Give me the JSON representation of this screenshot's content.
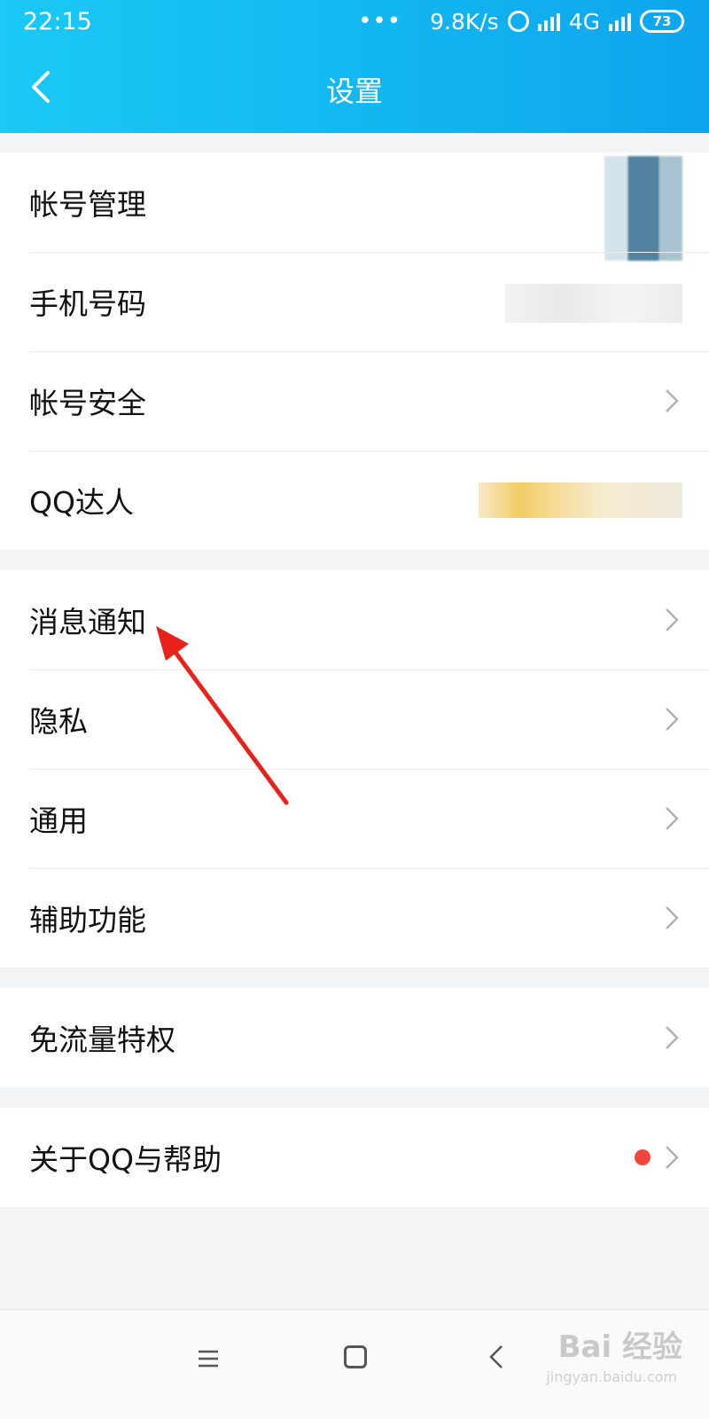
{
  "status_bar": {
    "time": "22:15",
    "dots": "•••",
    "speed": "9.8K/s",
    "network": "4G",
    "battery": "73"
  },
  "header": {
    "title": "设置"
  },
  "groups": [
    {
      "items": [
        {
          "label": "帐号管理",
          "icon": "blurred-avatar"
        },
        {
          "label": "手机号码",
          "icon": "blurred-phone"
        },
        {
          "label": "帐号安全",
          "icon": "chevron-right-icon"
        },
        {
          "label": "QQ达人",
          "icon": "blurred-badge"
        }
      ]
    },
    {
      "items": [
        {
          "label": "消息通知",
          "icon": "chevron-right-icon"
        },
        {
          "label": "隐私",
          "icon": "chevron-right-icon"
        },
        {
          "label": "通用",
          "icon": "chevron-right-icon"
        },
        {
          "label": "辅助功能",
          "icon": "chevron-right-icon"
        }
      ]
    },
    {
      "items": [
        {
          "label": "免流量特权",
          "icon": "chevron-right-icon"
        }
      ]
    },
    {
      "items": [
        {
          "label": "关于QQ与帮助",
          "icon": "chevron-right-icon",
          "badge": "red-dot"
        }
      ]
    }
  ],
  "watermark": {
    "text": "Bai 经验",
    "sub": "jingyan.baidu.com"
  },
  "colors": {
    "header_start": "#1ac9f5",
    "header_end": "#0ea5ee",
    "background": "#f3f4f6",
    "red_dot": "#f0463c",
    "annotation_arrow": "#e8231b"
  }
}
